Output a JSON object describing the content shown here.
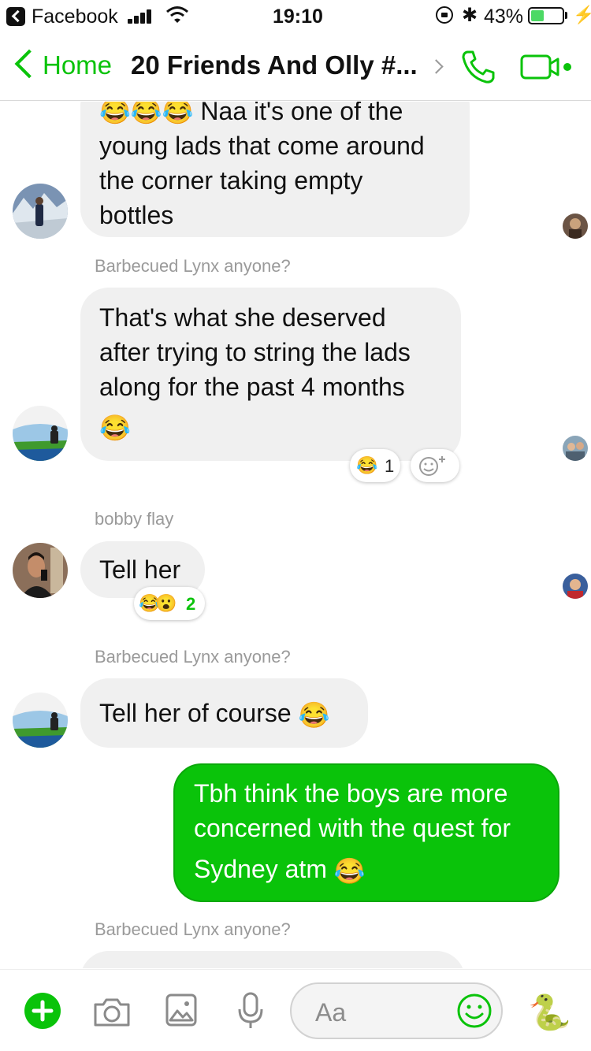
{
  "status_bar": {
    "app_name": "Facebook",
    "time": "19:10",
    "battery_percent": "43%",
    "battery_level": 0.43
  },
  "nav": {
    "back_label": "Home",
    "title": "20 Friends And Olly #..."
  },
  "messages": [
    {
      "lines": [
        "😂😂😂 Naa it's one of the",
        "young lads that come around",
        "the corner taking empty",
        "bottles"
      ]
    },
    {
      "sender": "Barbecued Lynx anyone?",
      "lines": [
        "That's what she deserved",
        "after trying to string the lads",
        "along for the past 4 months"
      ],
      "emoji_line": "😂",
      "reaction_emoji": "😂",
      "reaction_count": "1"
    },
    {
      "sender": "bobby flay",
      "text": "Tell her",
      "reaction_emoji": "😂😮",
      "reaction_count": "2"
    },
    {
      "sender": "Barbecued Lynx anyone?",
      "text": "Tell her of course",
      "emoji": "😂"
    },
    {
      "lines": [
        "Tbh think the boys are more",
        "concerned with the quest for"
      ],
      "last_line": "Sydney atm",
      "emoji": "😂",
      "mine": true
    },
    {
      "sender": "Barbecued Lynx anyone?"
    }
  ],
  "composer": {
    "placeholder": "Aa",
    "sticker_emoji": "🐍"
  },
  "colors": {
    "accent": "#0ac30a",
    "bubble_grey": "#f0f0f0",
    "sender_grey": "#9a9a9a"
  }
}
